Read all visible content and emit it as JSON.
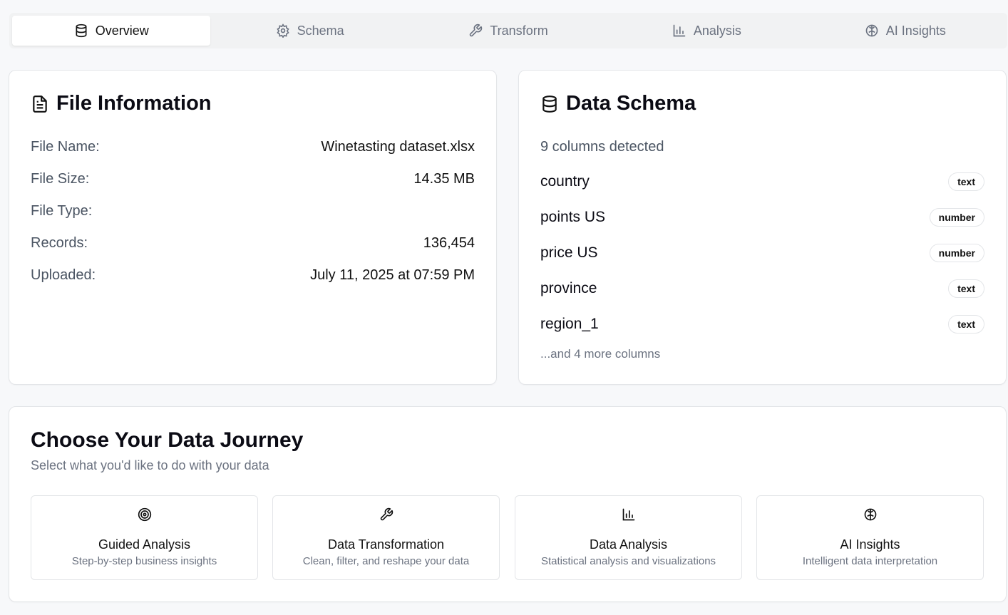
{
  "tabs": [
    {
      "label": "Overview",
      "icon": "database-icon",
      "active": true
    },
    {
      "label": "Schema",
      "icon": "gear-icon"
    },
    {
      "label": "Transform",
      "icon": "wrench-icon"
    },
    {
      "label": "Analysis",
      "icon": "bar-chart-icon"
    },
    {
      "label": "AI Insights",
      "icon": "brain-icon"
    }
  ],
  "file_info": {
    "title": "File Information",
    "icon": "file-text-icon",
    "rows": [
      {
        "label": "File Name:",
        "value": "Winetasting dataset.xlsx"
      },
      {
        "label": "File Size:",
        "value": "14.35 MB"
      },
      {
        "label": "File Type:",
        "value": ""
      },
      {
        "label": "Records:",
        "value": "136,454"
      },
      {
        "label": "Uploaded:",
        "value": "July 11, 2025 at 07:59 PM"
      }
    ]
  },
  "schema": {
    "title": "Data Schema",
    "icon": "database-icon",
    "subtitle": "9 columns detected",
    "columns": [
      {
        "name": "country",
        "type": "text"
      },
      {
        "name": "points US",
        "type": "number"
      },
      {
        "name": "price US",
        "type": "number"
      },
      {
        "name": "province",
        "type": "text"
      },
      {
        "name": "region_1",
        "type": "text"
      }
    ],
    "more": "...and 4 more columns"
  },
  "journey": {
    "title": "Choose Your Data Journey",
    "subtitle": "Select what you'd like to do with your data",
    "options": [
      {
        "title": "Guided Analysis",
        "desc": "Step-by-step business insights",
        "icon": "target-icon"
      },
      {
        "title": "Data Transformation",
        "desc": "Clean, filter, and reshape your data",
        "icon": "wrench-icon"
      },
      {
        "title": "Data Analysis",
        "desc": "Statistical analysis and visualizations",
        "icon": "bar-chart-icon"
      },
      {
        "title": "AI Insights",
        "desc": "Intelligent data interpretation",
        "icon": "brain-icon"
      }
    ]
  }
}
